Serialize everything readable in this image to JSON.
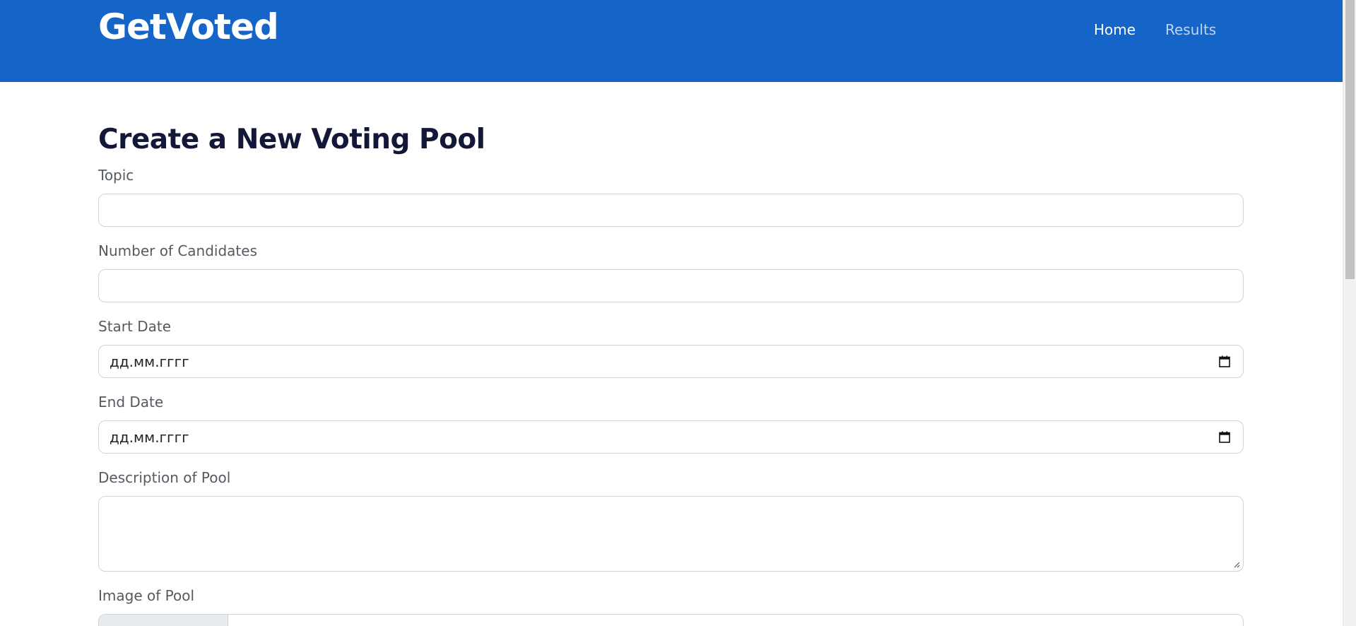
{
  "header": {
    "brand": "GetVoted",
    "nav": {
      "home": "Home",
      "results": "Results"
    }
  },
  "form": {
    "title": "Create a New Voting Pool",
    "topic": {
      "label": "Topic",
      "value": ""
    },
    "candidates": {
      "label": "Number of Candidates",
      "value": ""
    },
    "start_date": {
      "label": "Start Date",
      "placeholder": "дд.мм.гггг"
    },
    "end_date": {
      "label": "End Date",
      "placeholder": "дд.мм.гггг"
    },
    "description": {
      "label": "Description of Pool",
      "value": ""
    },
    "image": {
      "label": "Image of Pool"
    }
  },
  "colors": {
    "navbar": "#1565c8",
    "title": "#141838",
    "label": "#555a60",
    "border": "#ced4da"
  }
}
